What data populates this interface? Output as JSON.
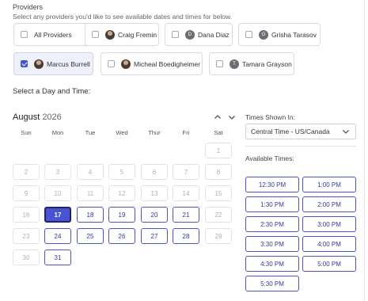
{
  "providers": {
    "title": "Providers",
    "subtitle": "Select any providers you'd like to see available dates and times for below.",
    "items": [
      {
        "label": "All Providers",
        "checked": false,
        "avatar": "none"
      },
      {
        "label": "Craig Fremin",
        "checked": false,
        "avatar": "photo"
      },
      {
        "label": "Dana Diaz",
        "checked": false,
        "avatar": "letter",
        "initial": "D"
      },
      {
        "label": "Grisha Tarasov",
        "checked": false,
        "avatar": "letter",
        "initial": "G"
      },
      {
        "label": "Marcus Burrell",
        "checked": true,
        "avatar": "photo"
      },
      {
        "label": "Micheal Boedigheimer",
        "checked": false,
        "avatar": "photo"
      },
      {
        "label": "Tamara Grayson",
        "checked": false,
        "avatar": "letter",
        "initial": "T"
      }
    ]
  },
  "calendar": {
    "heading": "Select a Day and Time:",
    "month": "August",
    "year": "2026",
    "prev_icon": "chevron-up-icon",
    "next_icon": "chevron-down-icon",
    "weekdays": [
      "Sun",
      "Mon",
      "Tue",
      "Wed",
      "Thur",
      "Fri",
      "Sat"
    ],
    "weeks": [
      [
        null,
        null,
        null,
        null,
        null,
        null,
        "1"
      ],
      [
        "2",
        "3",
        "4",
        "5",
        "6",
        "7",
        "8"
      ],
      [
        "9",
        "10",
        "11",
        "12",
        "13",
        "14",
        "15"
      ],
      [
        "16",
        "17",
        "18",
        "19",
        "20",
        "21",
        "22"
      ],
      [
        "23",
        "24",
        "25",
        "26",
        "27",
        "28",
        "29"
      ],
      [
        "30",
        "31",
        null,
        null,
        null,
        null,
        null
      ]
    ],
    "available_days": [
      "17",
      "18",
      "19",
      "20",
      "21",
      "24",
      "25",
      "26",
      "27",
      "28",
      "31"
    ],
    "selected_day": "17"
  },
  "times": {
    "timezone_label": "Times Shown In:",
    "timezone_value": "Central Time - US/Canada",
    "available_label": "Available Times:",
    "slots": [
      "12:30 PM",
      "1:00 PM",
      "1:30 PM",
      "2:00 PM",
      "2:30 PM",
      "3:00 PM",
      "3:30 PM",
      "4:00 PM",
      "4:30 PM",
      "5:00 PM",
      "5:30 PM"
    ]
  },
  "colors": {
    "accent": "#4a54d1",
    "accent_dark": "#1e2470",
    "selected_chip_bg": "#eef0fb"
  }
}
